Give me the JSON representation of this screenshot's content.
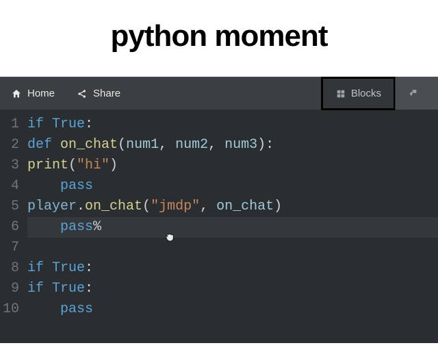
{
  "meme": {
    "title": "python moment"
  },
  "toolbar": {
    "home_label": "Home",
    "share_label": "Share",
    "blocks_label": "Blocks",
    "python_label": ""
  },
  "icons": {
    "home": "home-icon",
    "share": "share-icon",
    "blocks": "blocks-icon",
    "python": "python-icon"
  },
  "editor": {
    "highlighted_line": 6,
    "lines": [
      {
        "n": 1,
        "tokens": [
          {
            "t": "if",
            "c": "kw"
          },
          {
            "t": " ",
            "c": "punc"
          },
          {
            "t": "True",
            "c": "kw"
          },
          {
            "t": ":",
            "c": "punc"
          }
        ]
      },
      {
        "n": 2,
        "tokens": [
          {
            "t": "def",
            "c": "kw"
          },
          {
            "t": " ",
            "c": "punc"
          },
          {
            "t": "on_chat",
            "c": "fn"
          },
          {
            "t": "(",
            "c": "punc"
          },
          {
            "t": "num1",
            "c": "id"
          },
          {
            "t": ", ",
            "c": "punc"
          },
          {
            "t": "num2",
            "c": "id"
          },
          {
            "t": ", ",
            "c": "punc"
          },
          {
            "t": "num3",
            "c": "id"
          },
          {
            "t": "):",
            "c": "punc"
          }
        ]
      },
      {
        "n": 3,
        "tokens": [
          {
            "t": "print",
            "c": "fn"
          },
          {
            "t": "(",
            "c": "punc"
          },
          {
            "t": "\"hi\"",
            "c": "str"
          },
          {
            "t": ")",
            "c": "punc"
          }
        ]
      },
      {
        "n": 4,
        "tokens": [
          {
            "t": "    ",
            "c": "punc"
          },
          {
            "t": "pass",
            "c": "kw"
          }
        ]
      },
      {
        "n": 5,
        "tokens": [
          {
            "t": "player",
            "c": "obj"
          },
          {
            "t": ".",
            "c": "punc"
          },
          {
            "t": "on_chat",
            "c": "fn"
          },
          {
            "t": "(",
            "c": "punc"
          },
          {
            "t": "\"jmdp\"",
            "c": "str"
          },
          {
            "t": ", ",
            "c": "punc"
          },
          {
            "t": "on_chat",
            "c": "id"
          },
          {
            "t": ")",
            "c": "punc"
          }
        ]
      },
      {
        "n": 6,
        "tokens": [
          {
            "t": "    ",
            "c": "punc"
          },
          {
            "t": "pass",
            "c": "kw"
          },
          {
            "t": "%",
            "c": "punc"
          }
        ]
      },
      {
        "n": 7,
        "tokens": []
      },
      {
        "n": 8,
        "tokens": [
          {
            "t": "if",
            "c": "kw"
          },
          {
            "t": " ",
            "c": "punc"
          },
          {
            "t": "True",
            "c": "kw"
          },
          {
            "t": ":",
            "c": "punc"
          }
        ]
      },
      {
        "n": 9,
        "tokens": [
          {
            "t": "if",
            "c": "kw"
          },
          {
            "t": " ",
            "c": "punc"
          },
          {
            "t": "True",
            "c": "kw"
          },
          {
            "t": ":",
            "c": "punc"
          }
        ]
      },
      {
        "n": 10,
        "tokens": [
          {
            "t": "    ",
            "c": "punc"
          },
          {
            "t": "pass",
            "c": "kw"
          }
        ]
      }
    ]
  }
}
